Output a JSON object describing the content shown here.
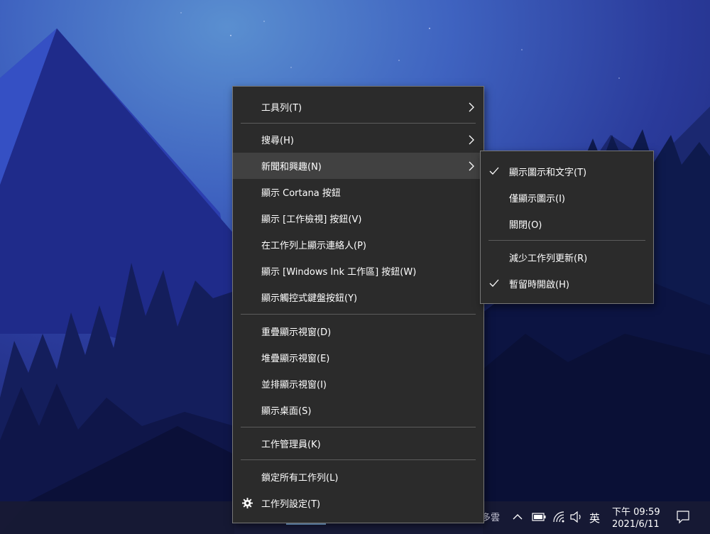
{
  "context_menu": {
    "items": [
      {
        "label": "工具列(T)",
        "has_submenu": true
      },
      {
        "label": "搜尋(H)",
        "has_submenu": true
      },
      {
        "label": "新聞和興趣(N)",
        "has_submenu": true,
        "highlighted": true
      },
      {
        "label": "顯示 Cortana 按鈕"
      },
      {
        "label": "顯示 [工作檢視] 按鈕(V)"
      },
      {
        "label": "在工作列上顯示連絡人(P)"
      },
      {
        "label": "顯示 [Windows Ink 工作區] 按鈕(W)"
      },
      {
        "label": "顯示觸控式鍵盤按鈕(Y)"
      },
      {
        "label": "重疊顯示視窗(D)"
      },
      {
        "label": "堆疊顯示視窗(E)"
      },
      {
        "label": "並排顯示視窗(I)"
      },
      {
        "label": "顯示桌面(S)"
      },
      {
        "label": "工作管理員(K)"
      },
      {
        "label": "鎖定所有工作列(L)"
      },
      {
        "label": "工作列設定(T)",
        "icon": "gear-icon"
      }
    ]
  },
  "submenu": {
    "items": [
      {
        "label": "顯示圖示和文字(T)",
        "checked": true
      },
      {
        "label": "僅顯示圖示(I)",
        "checked": false
      },
      {
        "label": "關閉(O)",
        "checked": false
      },
      {
        "label": "減少工作列更新(R)",
        "checked": false
      },
      {
        "label": "暫留時開啟(H)",
        "checked": true
      }
    ]
  },
  "taskbar": {
    "weather_text": "多雲",
    "ime": "英",
    "time": "下午 09:59",
    "date": "2021/6/11",
    "tray_icons": [
      "chevron-up-icon",
      "battery-icon",
      "wifi-icon",
      "volume-icon",
      "notification-icon"
    ]
  },
  "colors": {
    "menu_bg": "#2b2b2b",
    "menu_highlight": "#414141",
    "separator": "#5c5c5c",
    "text": "#ffffff"
  }
}
